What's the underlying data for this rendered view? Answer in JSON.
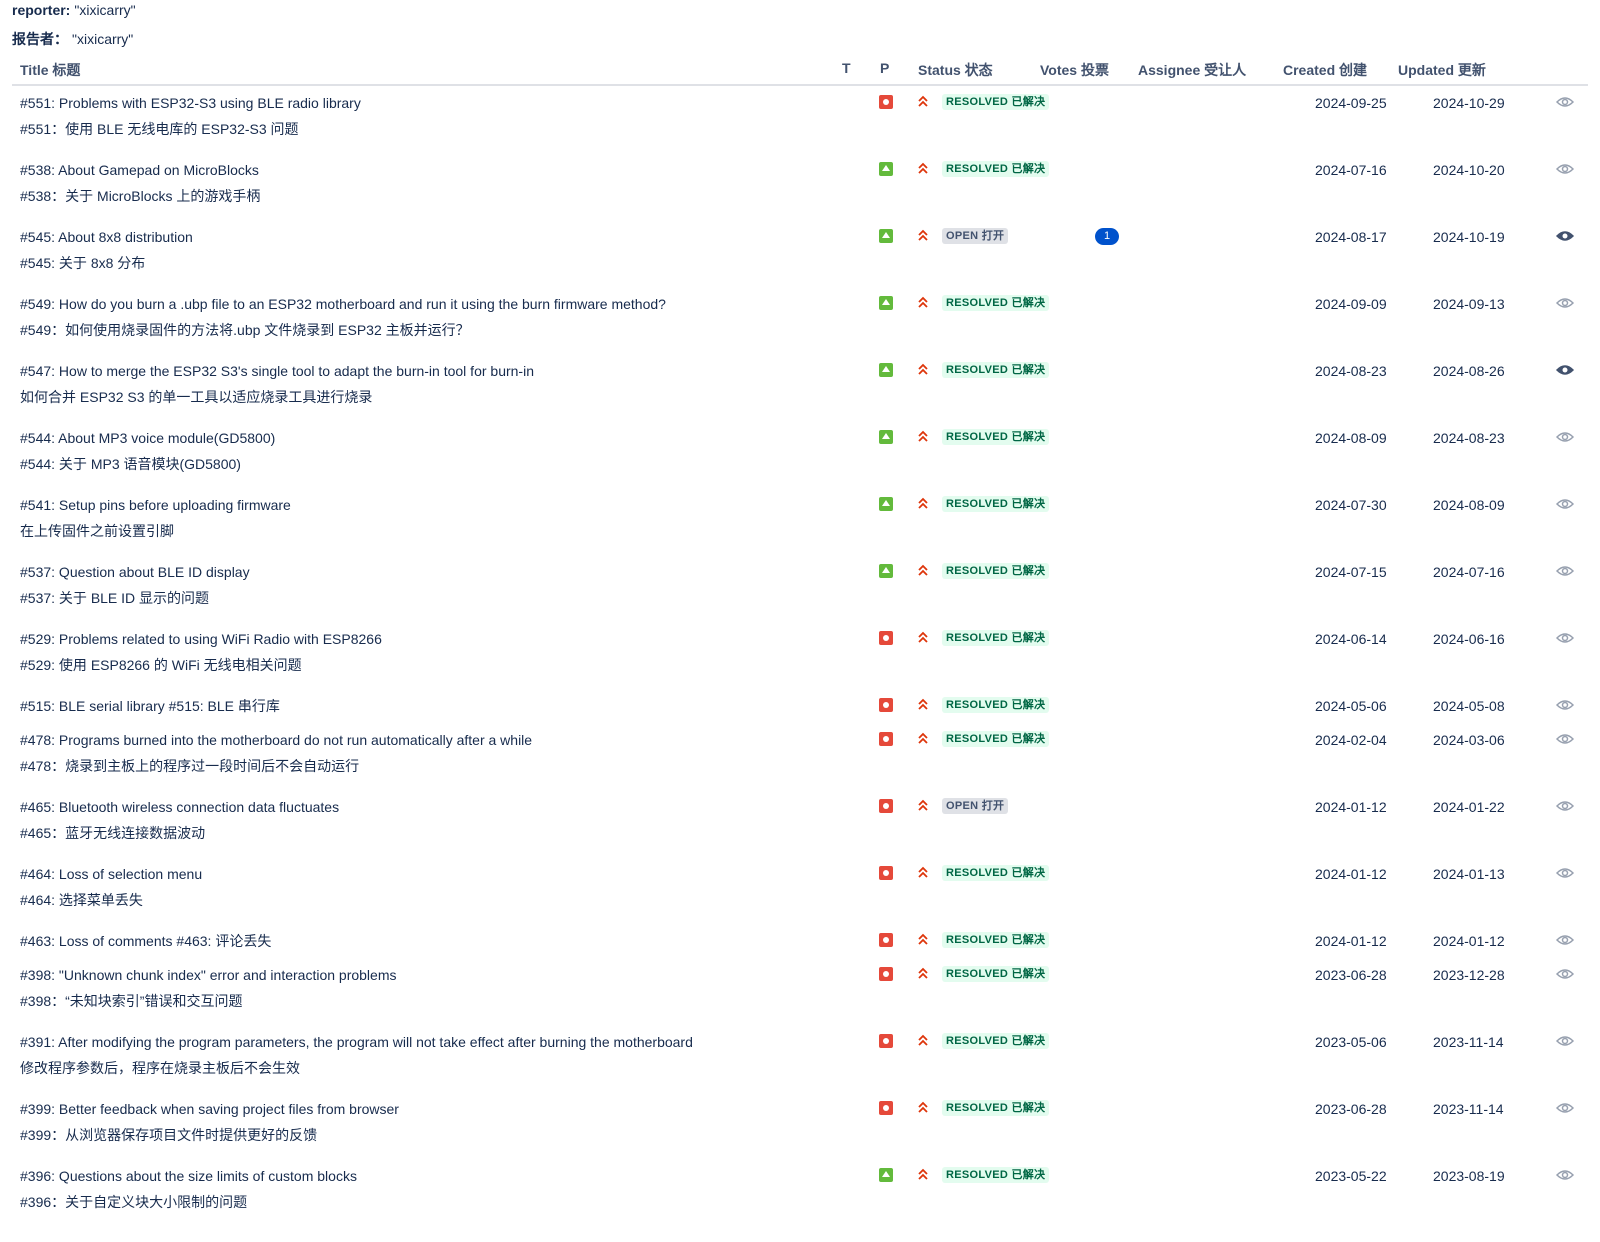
{
  "filters": [
    {
      "label": "reporter:",
      "value": "\"xixicarry\""
    },
    {
      "label": "报告者：",
      "value": "\"xixicarry\""
    }
  ],
  "columns": {
    "title": "Title 标题",
    "type": "T",
    "priority": "P",
    "status": "Status 状态",
    "votes": "Votes 投票",
    "assignee": "Assignee 受让人",
    "created": "Created 创建",
    "updated": "Updated 更新"
  },
  "colors": {
    "bug": "#e5493a",
    "improvement": "#63ba3c",
    "priority_high": "#de350b",
    "resolved_bg": "#e3fcef",
    "resolved_fg": "#006644",
    "open_bg": "#dfe1e6",
    "open_fg": "#42526e",
    "votes_badge": "#0052cc"
  },
  "issues": [
    {
      "title_en": "#551: Problems with ESP32-S3 using BLE radio library",
      "title_zh": "#551：使用 BLE 无线电库的 ESP32-S3 问题",
      "type": "bug-icon",
      "priority": "high-priority-icon",
      "status": "RESOLVED 已解决",
      "status_kind": "resolved",
      "votes": "",
      "created": "2024-09-25",
      "updated": "2024-10-29",
      "watching": false
    },
    {
      "title_en": "#538: About Gamepad on MicroBlocks",
      "title_zh": "#538：关于 MicroBlocks 上的游戏手柄",
      "type": "improvement-icon",
      "priority": "high-priority-icon",
      "status": "RESOLVED 已解决",
      "status_kind": "resolved",
      "votes": "",
      "created": "2024-07-16",
      "updated": "2024-10-20",
      "watching": false
    },
    {
      "title_en": "#545: About 8x8 distribution",
      "title_zh": "#545: 关于 8x8 分布",
      "type": "improvement-icon",
      "priority": "high-priority-icon",
      "status": "OPEN 打开",
      "status_kind": "open",
      "votes": "1",
      "created": "2024-08-17",
      "updated": "2024-10-19",
      "watching": true
    },
    {
      "title_en": "#549: How do you burn a .ubp file to an ESP32 motherboard and run it using the burn firmware method?",
      "title_zh": "#549：如何使用烧录固件的方法将.ubp 文件烧录到 ESP32 主板并运行？",
      "type": "improvement-icon",
      "priority": "high-priority-icon",
      "status": "RESOLVED 已解决",
      "status_kind": "resolved",
      "votes": "",
      "created": "2024-09-09",
      "updated": "2024-09-13",
      "watching": false
    },
    {
      "title_en": "#547: How to merge the ESP32 S3's single tool to adapt the burn-in tool for burn-in",
      "title_zh": "如何合并 ESP32 S3 的单一工具以适应烧录工具进行烧录",
      "type": "improvement-icon",
      "priority": "high-priority-icon",
      "status": "RESOLVED 已解决",
      "status_kind": "resolved",
      "votes": "",
      "created": "2024-08-23",
      "updated": "2024-08-26",
      "watching": true
    },
    {
      "title_en": "#544: About MP3 voice module(GD5800)",
      "title_zh": "#544: 关于 MP3 语音模块(GD5800)",
      "type": "improvement-icon",
      "priority": "high-priority-icon",
      "status": "RESOLVED 已解决",
      "status_kind": "resolved",
      "votes": "",
      "created": "2024-08-09",
      "updated": "2024-08-23",
      "watching": false
    },
    {
      "title_en": "#541: Setup pins before uploading firmware",
      "title_zh": "在上传固件之前设置引脚",
      "type": "improvement-icon",
      "priority": "high-priority-icon",
      "status": "RESOLVED 已解决",
      "status_kind": "resolved",
      "votes": "",
      "created": "2024-07-30",
      "updated": "2024-08-09",
      "watching": false
    },
    {
      "title_en": "#537: Question about BLE ID display",
      "title_zh": "#537: 关于 BLE ID 显示的问题",
      "type": "improvement-icon",
      "priority": "high-priority-icon",
      "status": "RESOLVED 已解决",
      "status_kind": "resolved",
      "votes": "",
      "created": "2024-07-15",
      "updated": "2024-07-16",
      "watching": false
    },
    {
      "title_en": "#529: Problems related to using WiFi Radio with ESP8266",
      "title_zh": "#529: 使用 ESP8266 的 WiFi 无线电相关问题",
      "type": "bug-icon",
      "priority": "high-priority-icon",
      "status": "RESOLVED 已解决",
      "status_kind": "resolved",
      "votes": "",
      "created": "2024-06-14",
      "updated": "2024-06-16",
      "watching": false
    },
    {
      "title_en": "#515: BLE serial library #515: BLE 串行库",
      "title_zh": "",
      "type": "bug-icon",
      "priority": "high-priority-icon",
      "status": "RESOLVED 已解决",
      "status_kind": "resolved",
      "votes": "",
      "created": "2024-05-06",
      "updated": "2024-05-08",
      "watching": false
    },
    {
      "title_en": "#478: Programs burned into the motherboard do not run automatically after a while",
      "title_zh": "#478：烧录到主板上的程序过一段时间后不会自动运行",
      "type": "bug-icon",
      "priority": "high-priority-icon",
      "status": "RESOLVED 已解决",
      "status_kind": "resolved",
      "votes": "",
      "created": "2024-02-04",
      "updated": "2024-03-06",
      "watching": false
    },
    {
      "title_en": "#465: Bluetooth wireless connection data fluctuates",
      "title_zh": "#465：蓝牙无线连接数据波动",
      "type": "bug-icon",
      "priority": "high-priority-icon",
      "status": "OPEN 打开",
      "status_kind": "open",
      "votes": "",
      "created": "2024-01-12",
      "updated": "2024-01-22",
      "watching": false
    },
    {
      "title_en": "#464: Loss of selection menu",
      "title_zh": "#464: 选择菜单丢失",
      "type": "bug-icon",
      "priority": "high-priority-icon",
      "status": "RESOLVED 已解决",
      "status_kind": "resolved",
      "votes": "",
      "created": "2024-01-12",
      "updated": "2024-01-13",
      "watching": false
    },
    {
      "title_en": "#463: Loss of comments #463: 评论丢失",
      "title_zh": "",
      "type": "bug-icon",
      "priority": "high-priority-icon",
      "status": "RESOLVED 已解决",
      "status_kind": "resolved",
      "votes": "",
      "created": "2024-01-12",
      "updated": "2024-01-12",
      "watching": false
    },
    {
      "title_en": "#398: \"Unknown chunk index\" error and interaction problems",
      "title_zh": "#398：“未知块索引”错误和交互问题",
      "type": "bug-icon",
      "priority": "high-priority-icon",
      "status": "RESOLVED 已解决",
      "status_kind": "resolved",
      "votes": "",
      "created": "2023-06-28",
      "updated": "2023-12-28",
      "watching": false
    },
    {
      "title_en": "#391: After modifying the program parameters, the program will not take effect after burning the motherboard",
      "title_zh": "修改程序参数后，程序在烧录主板后不会生效",
      "type": "bug-icon",
      "priority": "high-priority-icon",
      "status": "RESOLVED 已解决",
      "status_kind": "resolved",
      "votes": "",
      "created": "2023-05-06",
      "updated": "2023-11-14",
      "watching": false
    },
    {
      "title_en": "#399: Better feedback when saving project files from browser",
      "title_zh": "#399：从浏览器保存项目文件时提供更好的反馈",
      "type": "bug-icon",
      "priority": "high-priority-icon",
      "status": "RESOLVED 已解决",
      "status_kind": "resolved",
      "votes": "",
      "created": "2023-06-28",
      "updated": "2023-11-14",
      "watching": false
    },
    {
      "title_en": "#396: Questions about the size limits of custom blocks",
      "title_zh": "#396：关于自定义块大小限制的问题",
      "type": "improvement-icon",
      "priority": "high-priority-icon",
      "status": "RESOLVED 已解决",
      "status_kind": "resolved",
      "votes": "",
      "created": "2023-05-22",
      "updated": "2023-08-19",
      "watching": false
    }
  ]
}
